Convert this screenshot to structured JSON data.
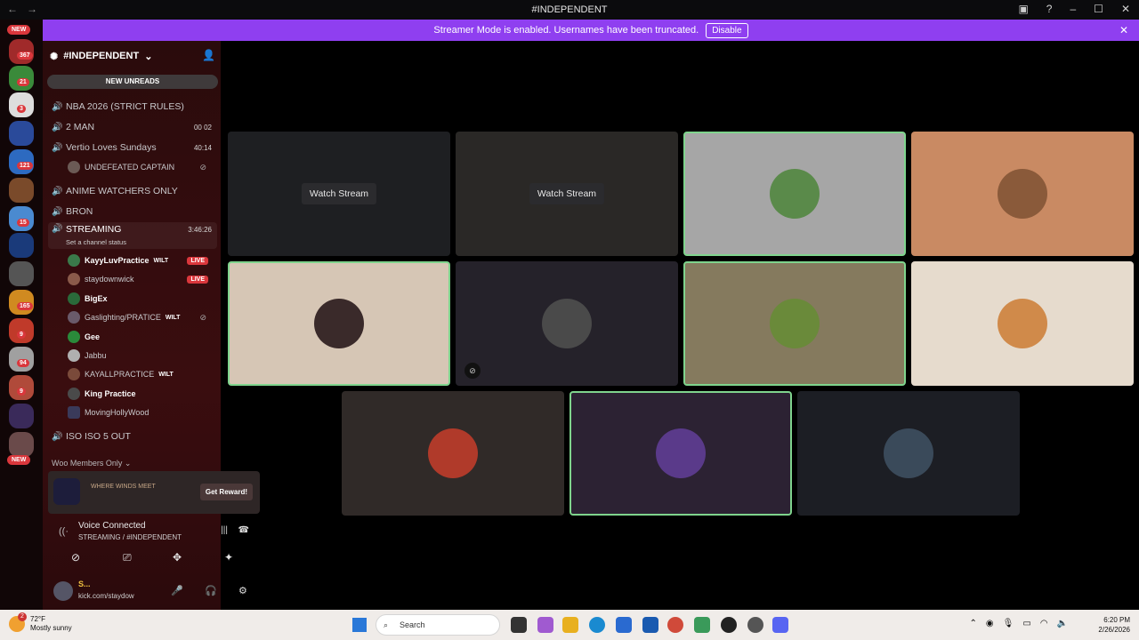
{
  "window": {
    "title": "#INDEPENDENT"
  },
  "banner": {
    "message": "Streamer Mode is enabled. Usernames have been truncated.",
    "disable_label": "Disable"
  },
  "servers": {
    "new_top": "NEW",
    "new_bottom": "NEW",
    "badges": [
      "367",
      "21",
      "3",
      "121",
      "15",
      "165",
      "9",
      "94",
      "9"
    ]
  },
  "channel_list": {
    "server_name": "#INDEPENDENT",
    "new_unreads": "NEW UNREADS",
    "channels": [
      {
        "name": "NBA 2026 (STRICT RULES)"
      },
      {
        "name": "2 MAN",
        "right": "00  02"
      },
      {
        "name": "Vertio Loves Sundays",
        "right": "40:14"
      },
      {
        "name": "ANIME WATCHERS ONLY"
      },
      {
        "name": "BRON"
      },
      {
        "name": "STREAMING",
        "right": "3:46:26",
        "status": "Set a channel status"
      },
      {
        "name": "ISO ISO 5 OUT"
      }
    ],
    "vertio_user": "UNDEFEATED CAPTAIN",
    "streaming_users": [
      {
        "name": "KayyLuvPractice",
        "tag": "WILT",
        "live": "LIVE"
      },
      {
        "name": "staydownwick",
        "live": "LIVE"
      },
      {
        "name": "BigEx"
      },
      {
        "name": "Gaslighting/PRATICE",
        "tag": "WILT"
      },
      {
        "name": "Gee"
      },
      {
        "name": "Jabbu"
      },
      {
        "name": "KAYALLPRACTICE",
        "tag": "WILT"
      },
      {
        "name": "King Practice"
      },
      {
        "name": "MovingHollyWood"
      }
    ],
    "section": "Woo Members Only"
  },
  "promo": {
    "brand": "WHERE WINDS MEET",
    "button": "Get Reward!"
  },
  "voice": {
    "status": "Voice Connected",
    "channel": "STREAMING / #INDEPENDENT"
  },
  "user_panel": {
    "name": "S...",
    "status": "kick.com/staydow"
  },
  "stage": {
    "watch_label": "Watch Stream"
  },
  "taskbar": {
    "temp": "72°F",
    "weather": "Mostly sunny",
    "search": "Search",
    "time": "6:20 PM",
    "date": "2/26/2026",
    "weather_badge": "2"
  }
}
